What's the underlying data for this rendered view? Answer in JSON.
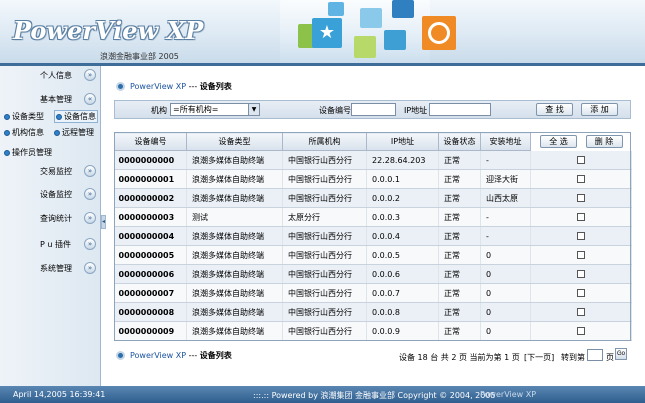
{
  "header": {
    "title": "PowerView XP",
    "subtitle": "浪潮金融事业部 2005"
  },
  "sidebar": {
    "sections": [
      {
        "label": "个人信息"
      },
      {
        "label": "基本管理"
      },
      {
        "label": "交易监控"
      },
      {
        "label": "设备监控"
      },
      {
        "label": "查询统计"
      },
      {
        "label": "P u 插件"
      },
      {
        "label": "系统管理"
      }
    ],
    "sub_items": [
      {
        "label": "设备类型"
      },
      {
        "label": "设备信息"
      },
      {
        "label": "机构信息"
      },
      {
        "label": "远程管理"
      },
      {
        "label": "操作员管理"
      }
    ]
  },
  "breadcrumb": {
    "root": "PowerView XP",
    "sep": "---",
    "current": "设备列表"
  },
  "search": {
    "org_label": "机构",
    "org_value": "=所有机构=",
    "device_no_label": "设备编号",
    "device_no_value": "",
    "ip_label": "IP地址",
    "ip_value": "",
    "find_button": "查 找",
    "add_button": "添 加"
  },
  "table": {
    "columns": [
      "设备编号",
      "设备类型",
      "所属机构",
      "IP地址",
      "设备状态",
      "安装地址"
    ],
    "select_all_button": "全 选",
    "delete_button": "删 除",
    "rows": [
      {
        "id": "0000000000",
        "type": "浪潮多媒体自助终端",
        "org": "中国银行山西分行",
        "ip": "22.28.64.203",
        "status": "正常",
        "addr": "-"
      },
      {
        "id": "0000000001",
        "type": "浪潮多媒体自助终端",
        "org": "中国银行山西分行",
        "ip": "0.0.0.1",
        "status": "正常",
        "addr": "迎泽大街"
      },
      {
        "id": "0000000002",
        "type": "浪潮多媒体自助终端",
        "org": "中国银行山西分行",
        "ip": "0.0.0.2",
        "status": "正常",
        "addr": "山西太原"
      },
      {
        "id": "0000000003",
        "type": "测试",
        "org": "太原分行",
        "ip": "0.0.0.3",
        "status": "正常",
        "addr": "-"
      },
      {
        "id": "0000000004",
        "type": "浪潮多媒体自助终端",
        "org": "中国银行山西分行",
        "ip": "0.0.0.4",
        "status": "正常",
        "addr": "-"
      },
      {
        "id": "0000000005",
        "type": "浪潮多媒体自助终端",
        "org": "中国银行山西分行",
        "ip": "0.0.0.5",
        "status": "正常",
        "addr": "0"
      },
      {
        "id": "0000000006",
        "type": "浪潮多媒体自助终端",
        "org": "中国银行山西分行",
        "ip": "0.0.0.6",
        "status": "正常",
        "addr": "0"
      },
      {
        "id": "0000000007",
        "type": "浪潮多媒体自助终端",
        "org": "中国银行山西分行",
        "ip": "0.0.0.7",
        "status": "正常",
        "addr": "0"
      },
      {
        "id": "0000000008",
        "type": "浪潮多媒体自助终端",
        "org": "中国银行山西分行",
        "ip": "0.0.0.8",
        "status": "正常",
        "addr": "0"
      },
      {
        "id": "0000000009",
        "type": "浪潮多媒体自助终端",
        "org": "中国银行山西分行",
        "ip": "0.0.0.9",
        "status": "正常",
        "addr": "0"
      }
    ]
  },
  "pager": {
    "summary": "设备 18 台 共 2 页 当前为第 1 页",
    "next": "[下一页]",
    "goto_label": "转到第",
    "page_suffix": "页",
    "go_button": "Go"
  },
  "footer": {
    "datetime": "April 14,2005 16:39:41",
    "copyright": ":::.:: Powered by 浪潮集团 金融事业部 Copyright © 2004, 2005",
    "product": "PowerView XP"
  }
}
